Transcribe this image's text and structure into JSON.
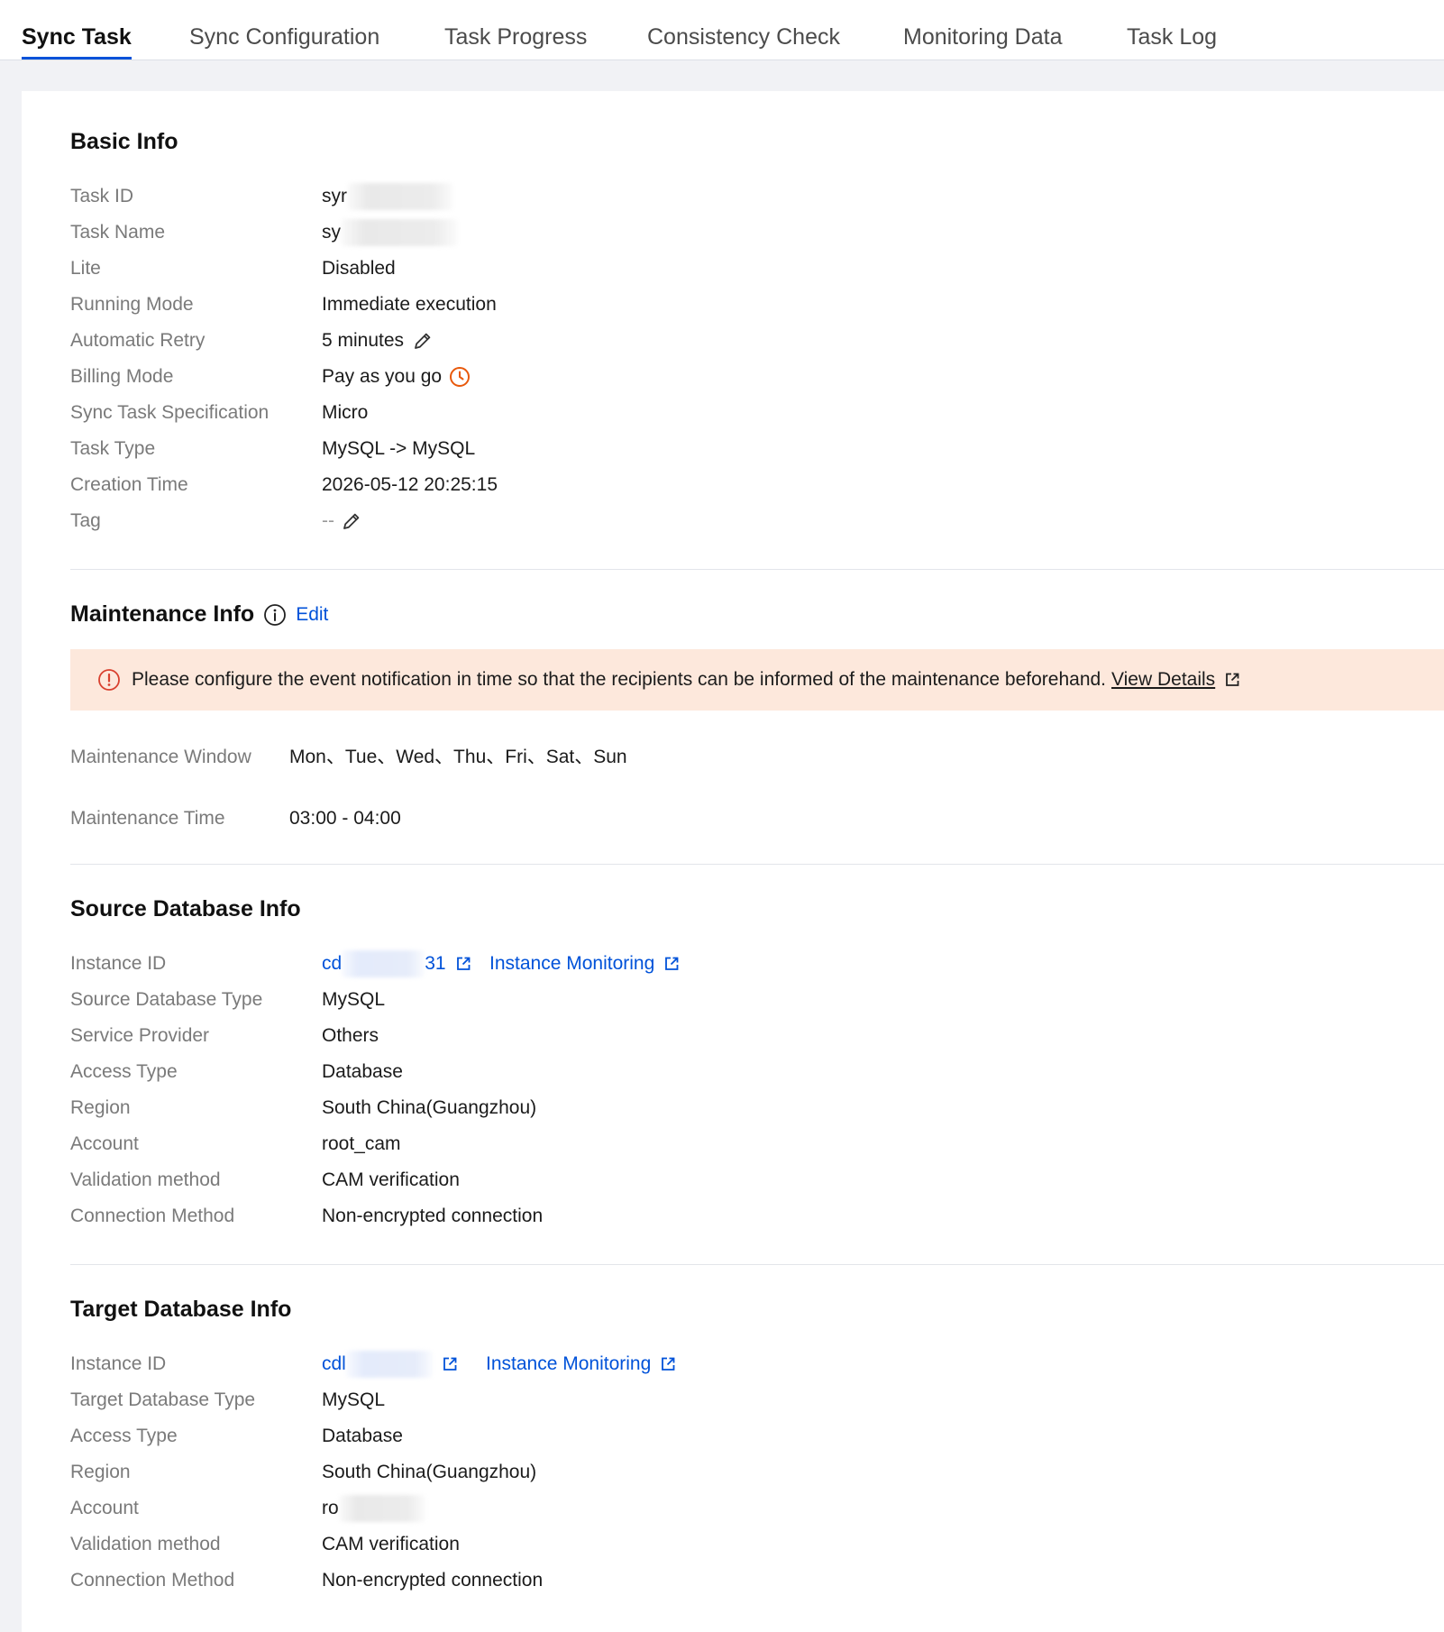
{
  "tabs": [
    {
      "label": "Sync Task",
      "active": true
    },
    {
      "label": "Sync Configuration",
      "active": false
    },
    {
      "label": "Task Progress",
      "active": false
    },
    {
      "label": "Consistency Check",
      "active": false
    },
    {
      "label": "Monitoring Data",
      "active": false
    },
    {
      "label": "Task Log",
      "active": false
    }
  ],
  "basic_info": {
    "title": "Basic Info",
    "task_id": {
      "label": "Task ID",
      "value": "syr"
    },
    "task_name": {
      "label": "Task Name",
      "value": "sy"
    },
    "lite": {
      "label": "Lite",
      "value": "Disabled"
    },
    "running_mode": {
      "label": "Running Mode",
      "value": "Immediate execution"
    },
    "automatic_retry": {
      "label": "Automatic Retry",
      "value": "5 minutes"
    },
    "billing_mode": {
      "label": "Billing Mode",
      "value": "Pay as you go"
    },
    "spec": {
      "label": "Sync Task Specification",
      "value": "Micro"
    },
    "task_type": {
      "label": "Task Type",
      "value": "MySQL -> MySQL"
    },
    "creation_time": {
      "label": "Creation Time",
      "value": "2026-05-12 20:25:15"
    },
    "tag": {
      "label": "Tag",
      "value": "--"
    }
  },
  "maintenance_info": {
    "title": "Maintenance Info",
    "edit_label": "Edit",
    "alert_text": "Please configure the event notification in time so that the recipients can be informed of the maintenance beforehand.",
    "alert_link": "View Details",
    "window": {
      "label": "Maintenance Window",
      "value": "Mon、Tue、Wed、Thu、Fri、Sat、Sun"
    },
    "time": {
      "label": "Maintenance Time",
      "value": "03:00 - 04:00"
    }
  },
  "source_db": {
    "title": "Source Database Info",
    "instance_id": {
      "label": "Instance ID",
      "value_prefix": "cd",
      "value_suffix": "31"
    },
    "monitoring_label": "Instance Monitoring",
    "db_type": {
      "label": "Source Database Type",
      "value": "MySQL"
    },
    "provider": {
      "label": "Service Provider",
      "value": "Others"
    },
    "access_type": {
      "label": "Access Type",
      "value": "Database"
    },
    "region": {
      "label": "Region",
      "value": "South China(Guangzhou)"
    },
    "account": {
      "label": "Account",
      "value": "root_cam"
    },
    "validation": {
      "label": "Validation method",
      "value": "CAM verification"
    },
    "connection": {
      "label": "Connection Method",
      "value": "Non-encrypted connection"
    }
  },
  "target_db": {
    "title": "Target Database Info",
    "instance_id": {
      "label": "Instance ID",
      "value_prefix": "cdl"
    },
    "monitoring_label": "Instance Monitoring",
    "db_type": {
      "label": "Target Database Type",
      "value": "MySQL"
    },
    "access_type": {
      "label": "Access Type",
      "value": "Database"
    },
    "region": {
      "label": "Region",
      "value": "South China(Guangzhou)"
    },
    "account": {
      "label": "Account",
      "value": "ro"
    },
    "validation": {
      "label": "Validation method",
      "value": "CAM verification"
    },
    "connection": {
      "label": "Connection Method",
      "value": "Non-encrypted connection"
    }
  },
  "colors": {
    "link": "#0052d9",
    "alert_bg": "#fde8dc",
    "warning": "#e8590c",
    "error": "#d9412f"
  }
}
